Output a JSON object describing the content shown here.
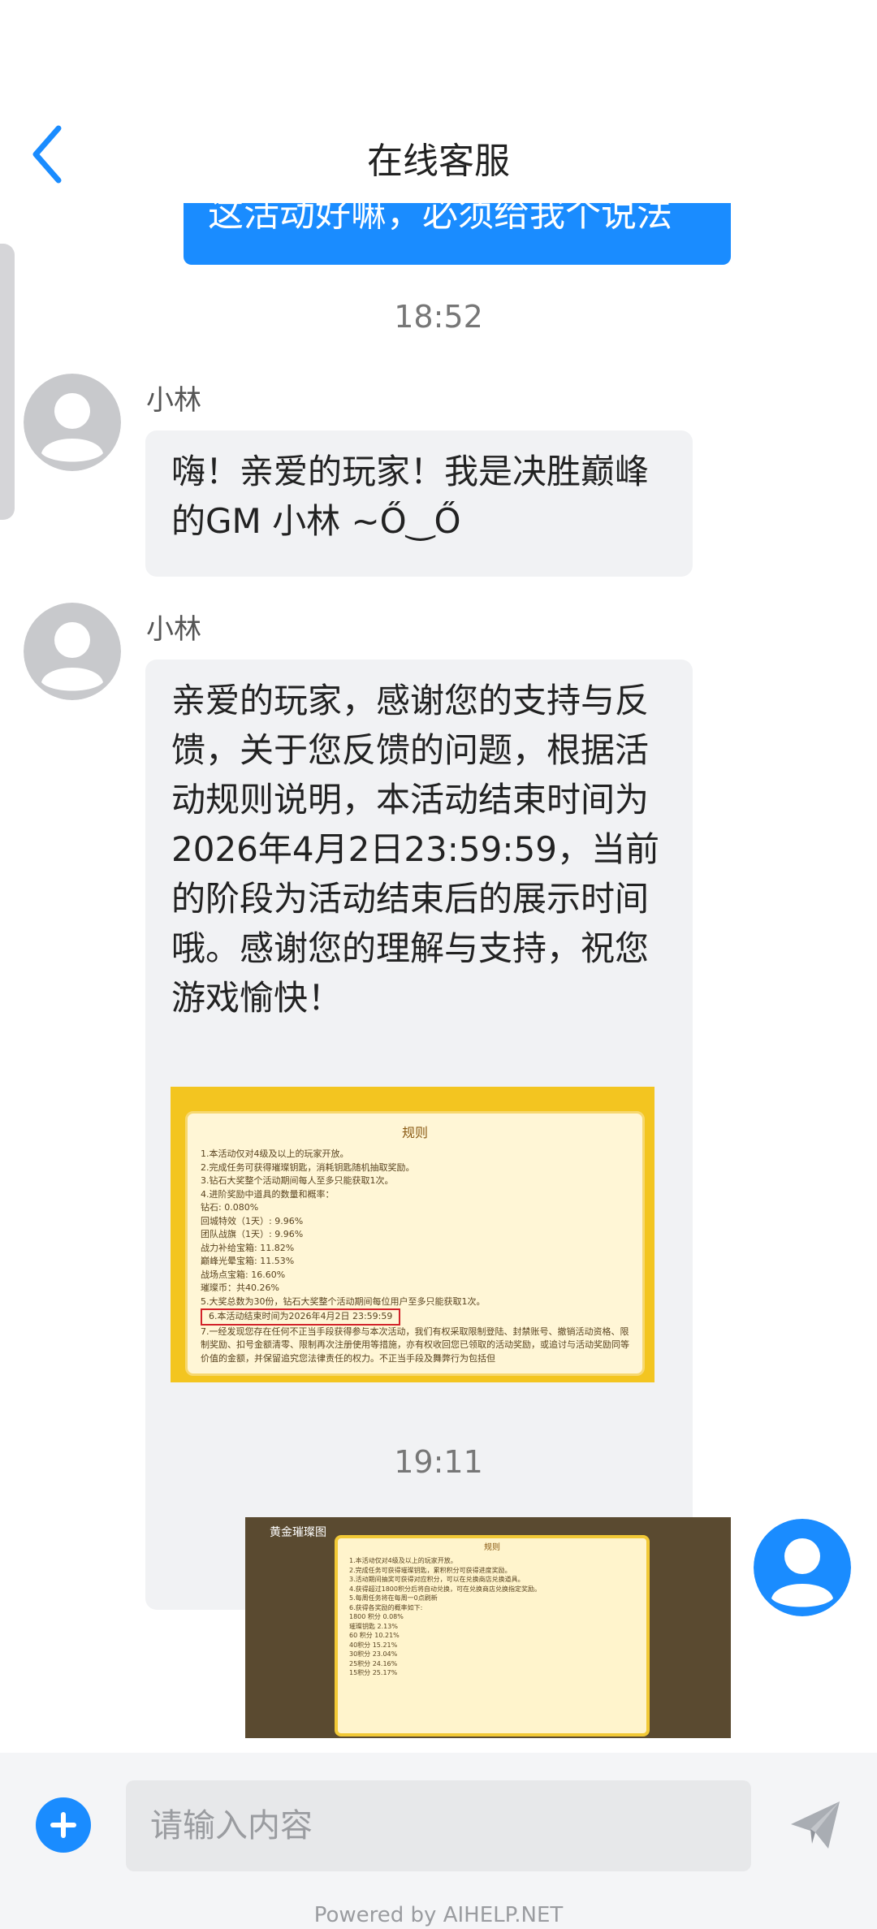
{
  "header": {
    "title": "在线客服"
  },
  "chat": {
    "previous_user_message_fragment": "这活动好嘛，必须给我个说法",
    "time1": "18:52",
    "agent_name": "小林",
    "greeting": "嗨！亲爱的玩家！我是决胜巅峰的GM 小林 ~Ő‿Ő",
    "reply": "亲爱的玩家，感谢您的支持与反馈，关于您反馈的问题，根据活动规则说明，本活动结束时间为2026年4月2日23:59:59，当前的阶段为活动结束后的展示时间哦。感谢您的理解与支持，祝您游戏愉快！",
    "rules_image": {
      "title": "规则",
      "lines": [
        "1.本活动仅对4级及以上的玩家开放。",
        "2.完成任务可获得璀璨钥匙，消耗钥匙随机抽取奖励。",
        "3.钻石大奖整个活动期间每人至多只能获取1次。",
        "4.进阶奖励中道具的数量和概率：",
        "钻石: 0.080%",
        "回城特效（1天）: 9.96%",
        "团队战旗（1天）: 9.96%",
        "战力补给宝箱: 11.82%",
        "巅峰光晕宝箱: 11.53%",
        "战场点宝箱: 16.60%",
        "璀璨币：共40.26%",
        "5.大奖总数为30份，钻石大奖整个活动期间每位用户至多只能获取1次。",
        "7.一经发现您存在任何不正当手段获得参与本次活动，我们有权采取限制登陆、封禁账号、撤销活动资格、限制奖励、扣号金额清零、限制再次注册使用等措施，亦有权收回您已领取的活动奖励，或追讨与活动奖励同等价值的金额，并保留追究您法律责任的权力。不正当手段及舞弊行为包括但"
      ],
      "highlight": "6.本活动结束时间为2026年4月2日 23:59:59"
    },
    "time2": "19:11",
    "game_image": {
      "top_label": "黄金璀璨图",
      "title": "规则",
      "lines": [
        "1.本活动仅对4级及以上的玩家开放。",
        "2.完成任务可获得璀璨钥匙，累积积分可获得进度奖励。",
        "3.活动期间抽奖可获得对应积分，可以在兑换商店兑换道具。",
        "4.获得超过1800积分后将自动兑换，可在兑换商店兑换指定奖励。",
        "5.每周任务将在每周一0点刷新",
        "6.获得各奖励的概率如下:",
        "1800 积分 0.08%",
        "璀璨钥匙 2.13%",
        "60 积分 10.21%",
        "40积分 15.21%",
        "30积分 23.04%",
        "25积分 24.16%",
        "15积分 25.17%"
      ]
    }
  },
  "composer": {
    "placeholder": "请输入内容",
    "powered_by": "Powered by AIHELP.NET"
  },
  "colors": {
    "accent": "#1a8cff",
    "bubble_gray": "#f1f2f4",
    "avatar_gray": "#c8c9cc"
  }
}
